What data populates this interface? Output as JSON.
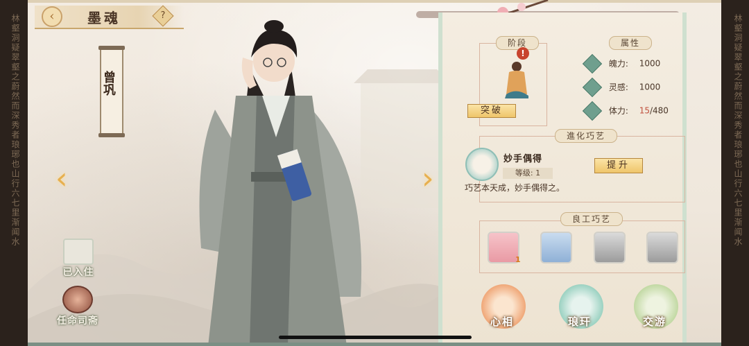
{
  "side_left_text": "林壑洞疑翠壑之蔚然而深秀者琅琊也山行六七里渐闻水",
  "side_right_text": "林壑洞疑翠壑之蔚然而深秀者琅琊也山行六七里渐闻水",
  "header": {
    "back_icon": "back-arrow-icon",
    "title": "墨魂",
    "help": "?"
  },
  "character": {
    "name": "曾巩"
  },
  "left_buttons": {
    "residence": "已入住",
    "appoint": "任命司斋"
  },
  "panel": {
    "stage_label": "阶段",
    "alert": "!",
    "break_button": "突破",
    "attributes_label": "属性",
    "stats": [
      {
        "label": "魄力:",
        "value": "1000"
      },
      {
        "label": "灵感:",
        "value": "1000"
      },
      {
        "label": "体力:",
        "current": "15",
        "max": "/480"
      }
    ],
    "evolve_label": "進化巧艺",
    "skill": {
      "name": "妙手偶得",
      "level": "等级: 1",
      "desc": "巧艺本天成，妙手偶得之。",
      "upgrade": "提升"
    },
    "craft_label": "良工巧艺",
    "craft_badge": "1",
    "bottom": [
      {
        "label": "心相"
      },
      {
        "label": "琅玕"
      },
      {
        "label": "交游"
      }
    ]
  }
}
